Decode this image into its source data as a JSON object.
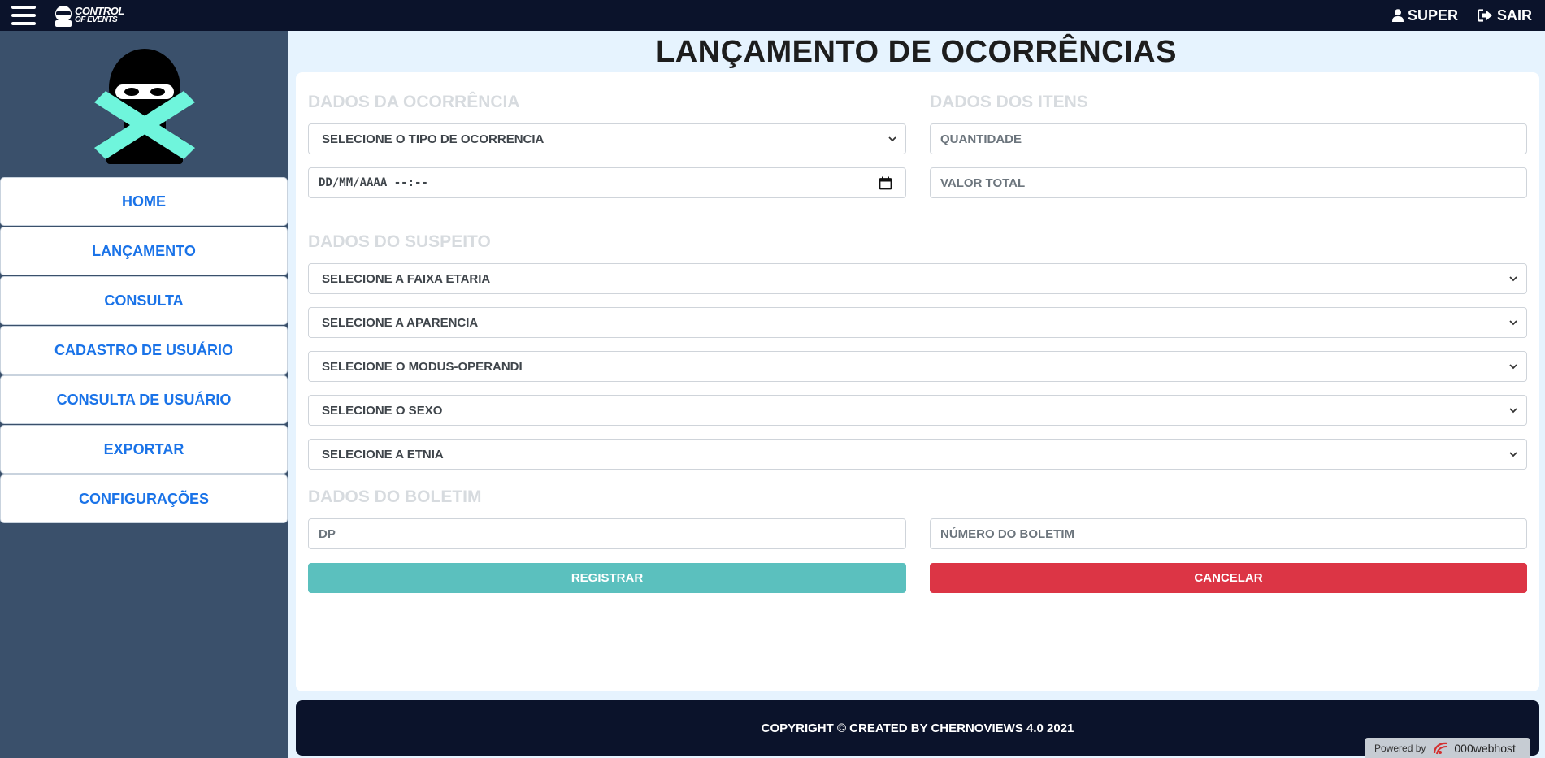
{
  "header": {
    "brand_line1": "CONTROL",
    "brand_line2": "OF EVENTS",
    "user_label": "SUPER",
    "logout_label": "SAIR"
  },
  "sidebar": {
    "items": [
      {
        "label": "HOME"
      },
      {
        "label": "LANÇAMENTO"
      },
      {
        "label": "CONSULTA"
      },
      {
        "label": "CADASTRO DE USUÁRIO"
      },
      {
        "label": "CONSULTA DE USUÁRIO"
      },
      {
        "label": "EXPORTAR"
      },
      {
        "label": "CONFIGURAÇÕES"
      }
    ]
  },
  "main": {
    "title": "LANÇAMENTO DE OCORRÊNCIAS",
    "sections": {
      "ocorrencia": "DADOS DA OCORRÊNCIA",
      "itens": "DADOS DOS ITENS",
      "suspeito": "DADOS DO SUSPEITO",
      "boletim": "DADOS DO BOLETIM"
    },
    "fields": {
      "tipo_ocorrencia": "SELECIONE O TIPO DE OCORRENCIA",
      "data_hora": "DD/MM/AAAA --:--",
      "quantidade": "QUANTIDADE",
      "valor_total": "VALOR TOTAL",
      "faixa_etaria": "SELECIONE A FAIXA ETARIA",
      "aparencia": "SELECIONE A APARENCIA",
      "modus_operandi": "SELECIONE O MODUS-OPERANDI",
      "sexo": "SELECIONE O SEXO",
      "etnia": "SELECIONE A ETNIA",
      "dp": "DP",
      "numero_boletim": "NÚMERO DO BOLETIM"
    },
    "buttons": {
      "register": "REGISTRAR",
      "cancel": "CANCELAR"
    }
  },
  "footer": {
    "copyright": "COPYRIGHT © CREATED BY CHERNOVIEWS 4.0 2021"
  },
  "badge": {
    "powered": "Powered by",
    "host": "000webhost"
  },
  "colors": {
    "topbar": "#0b132b",
    "sidebar": "#3a506b",
    "accent_teal": "#5bc0be",
    "danger": "#dc3545",
    "link": "#1a73e8",
    "page_bg": "#e6f3fe",
    "mask": "#6ff5dc"
  },
  "icons": {
    "menu": "hamburger-icon",
    "user": "user-icon",
    "logout": "sign-out-icon",
    "calendar": "calendar-icon",
    "dropdown": "chevron-down-icon"
  }
}
